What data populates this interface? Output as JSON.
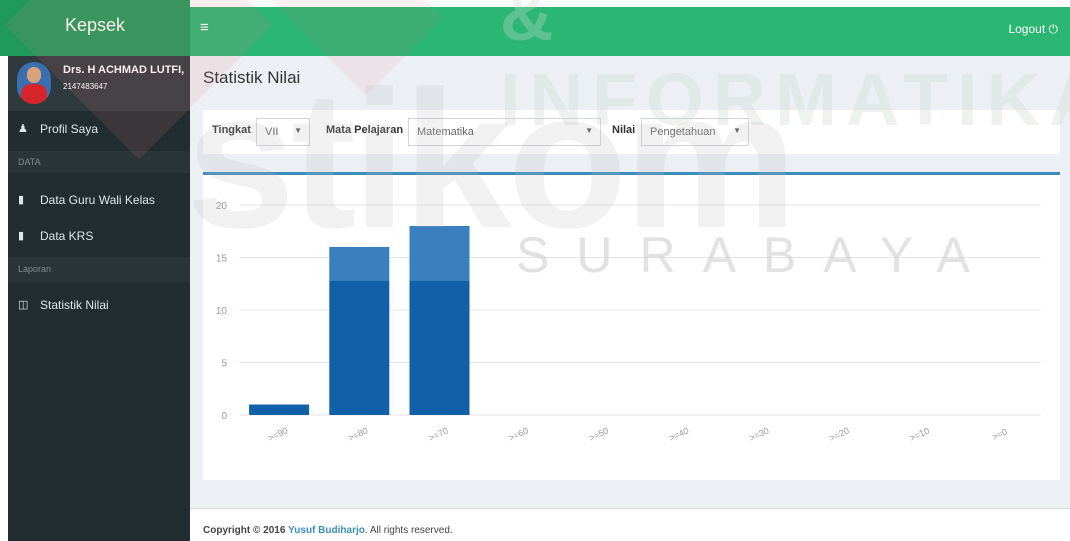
{
  "header": {
    "brand": "Kepsek",
    "menu_icon": "≡",
    "logout_label": "Logout"
  },
  "user": {
    "name": "Drs. H ACHMAD LUTFI,",
    "id": "2147483647"
  },
  "sidebar": {
    "items": [
      {
        "icon": "user-icon",
        "label": "Profil Saya"
      },
      {
        "header": "DATA"
      },
      {
        "icon": "file-icon",
        "label": "Data Guru Wali Kelas"
      },
      {
        "icon": "file-icon",
        "label": "Data KRS"
      },
      {
        "header": "Laporan"
      },
      {
        "icon": "file-chart-icon",
        "label": "Statistik Nilai"
      }
    ]
  },
  "page": {
    "title": "Statistik Nilai"
  },
  "filters": {
    "tingkat_label": "Tingkat",
    "tingkat_value": "VII",
    "mapel_label": "Mata Pelajaran",
    "mapel_value": "Matematika",
    "nilai_label": "Nilai",
    "nilai_value": "Pengetahuan"
  },
  "chart_data": {
    "type": "bar",
    "categories": [
      ">=90",
      ">=80",
      ">=70",
      ">=60",
      ">=50",
      ">=40",
      ">=30",
      ">=20",
      ">=10",
      ">=0"
    ],
    "series": [
      {
        "values": [
          1,
          16,
          18,
          0,
          0,
          0,
          0,
          0,
          0,
          0
        ]
      }
    ],
    "yticks": [
      0,
      5,
      10,
      15,
      20
    ],
    "ylim": [
      0,
      20
    ],
    "title": "",
    "xlabel": "",
    "ylabel": "",
    "grid": true,
    "colors": {
      "bar": "#1261a8",
      "bar_top": "#3a7fbf"
    }
  },
  "footer": {
    "prefix": "Copyright © 2016",
    "author": "Yusuf Budiharjo",
    "suffix": ". All rights reserved."
  },
  "watermark": {
    "brand": "stikom",
    "top": "& INFORMATIKA",
    "sub": "SURABAYA"
  }
}
